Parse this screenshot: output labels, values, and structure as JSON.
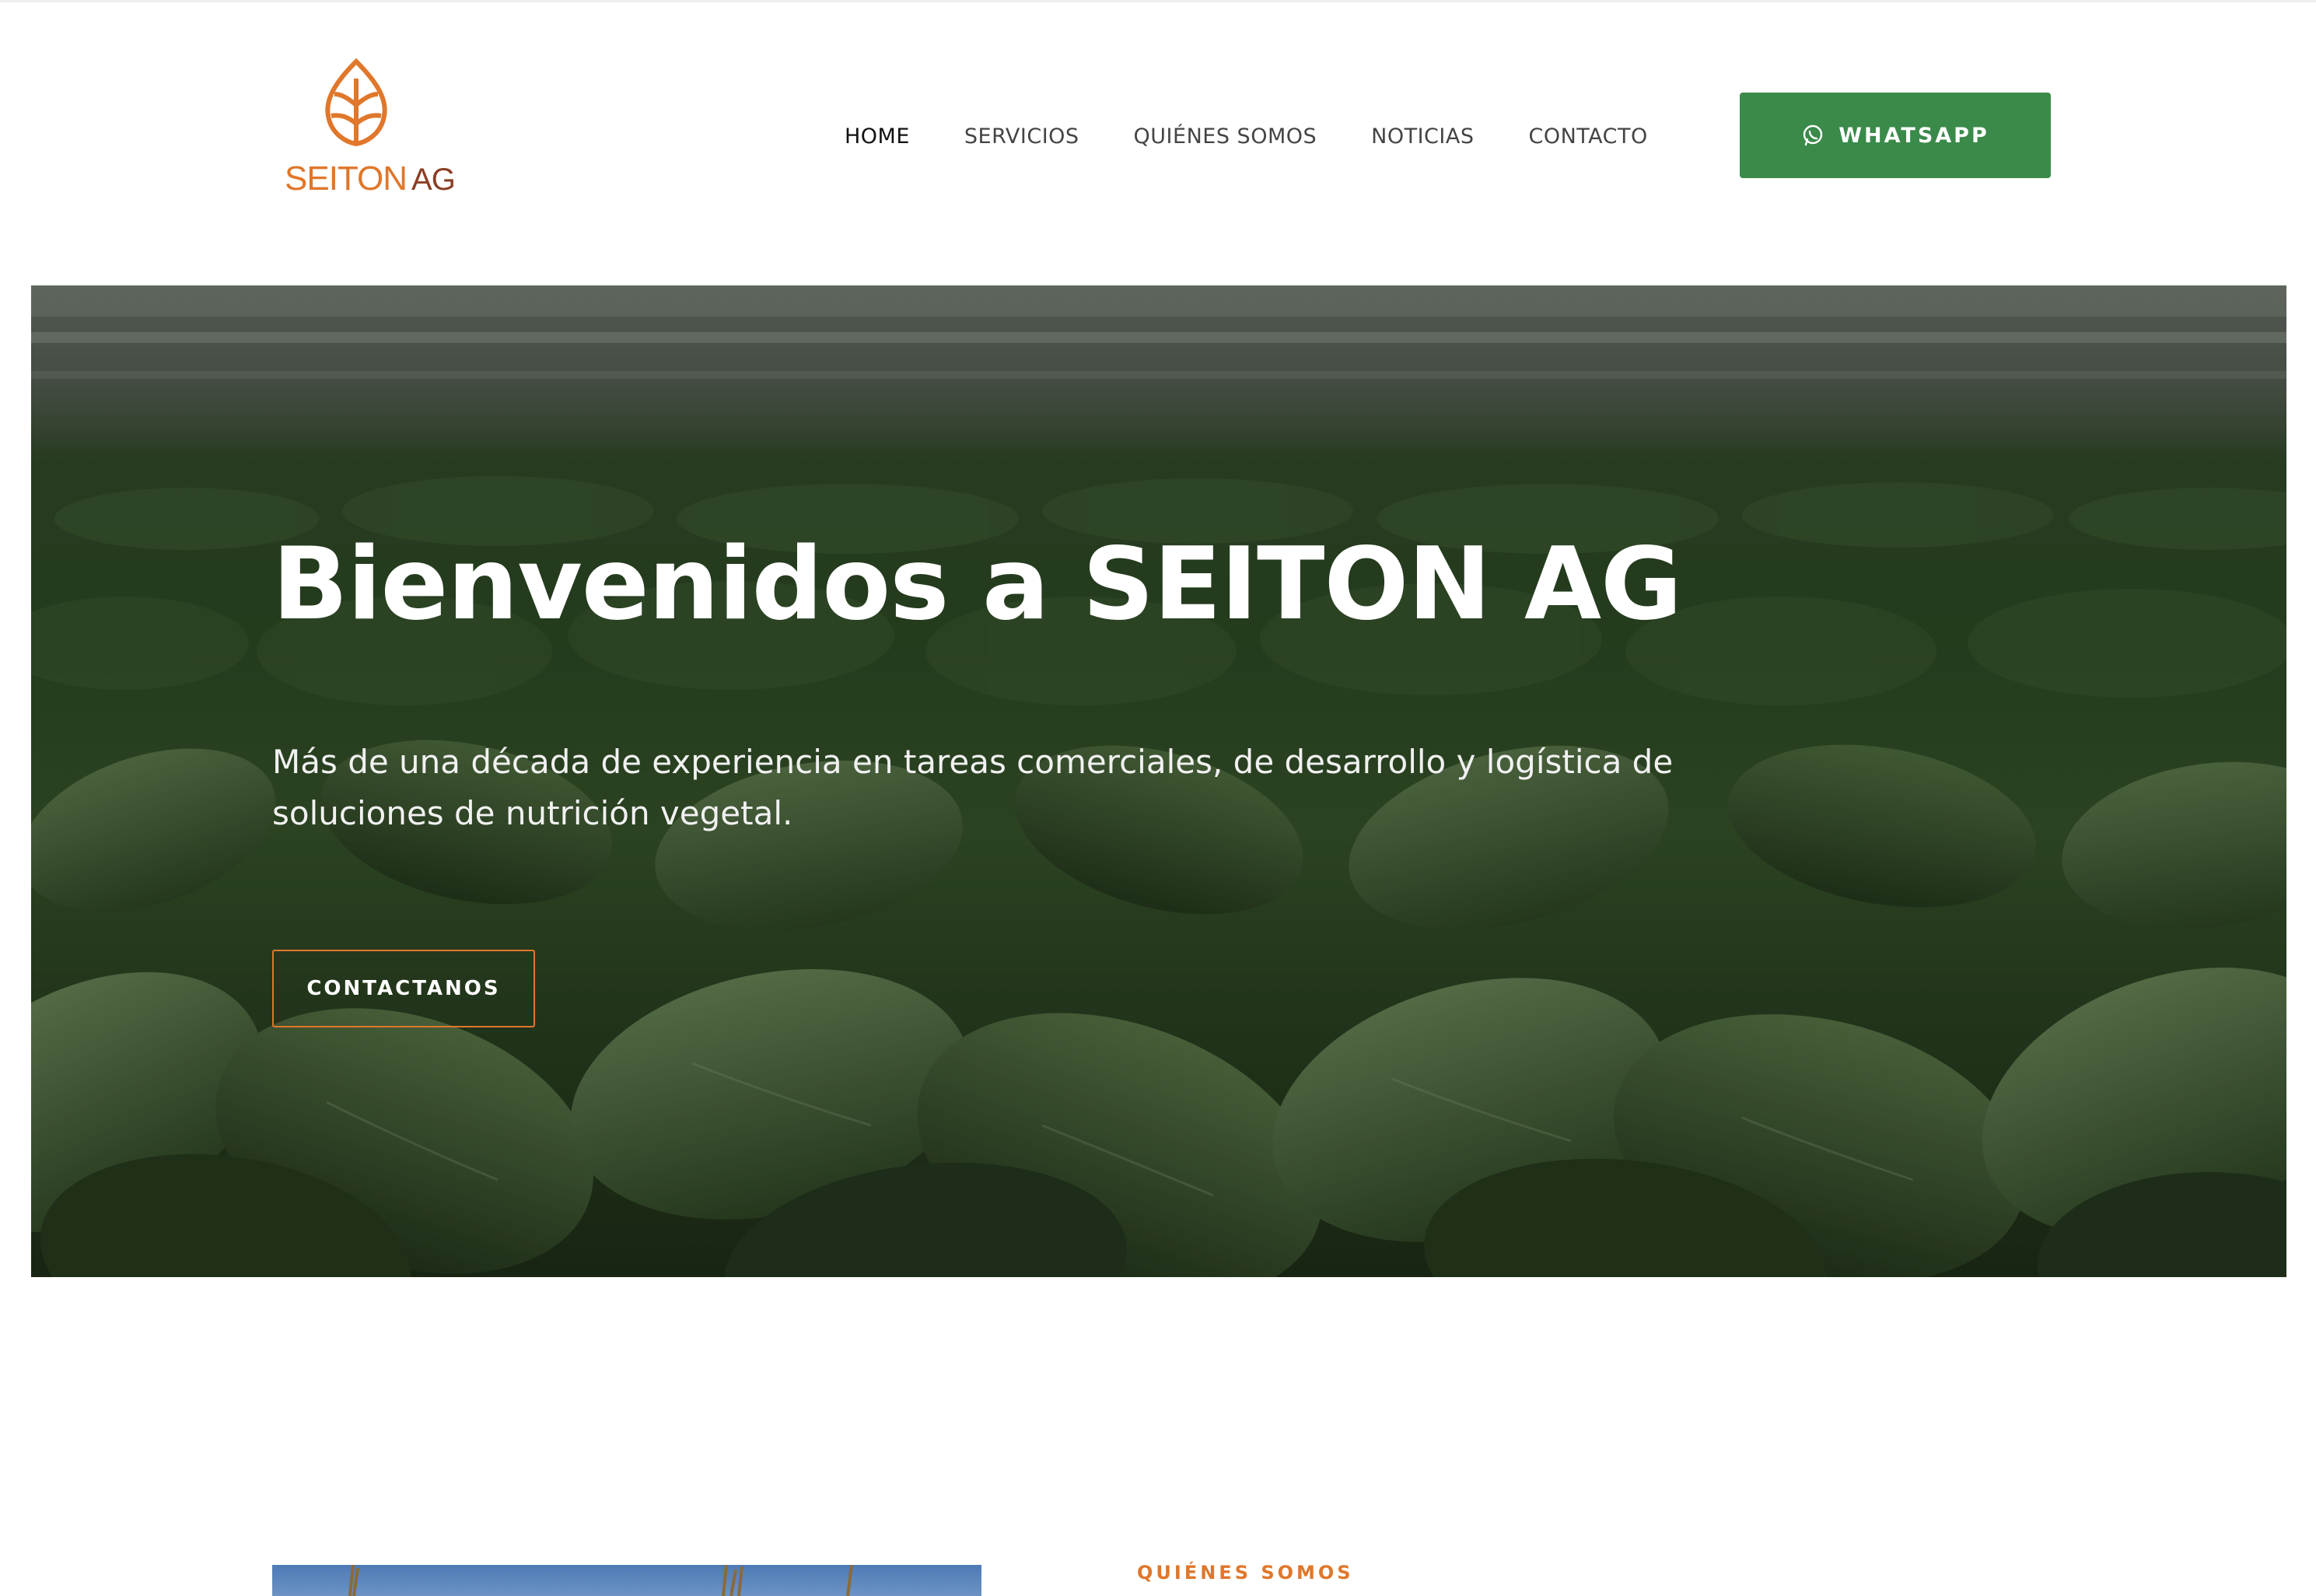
{
  "header": {
    "logo": {
      "text_main": "SEITON",
      "text_suffix": "AG",
      "colors": {
        "primary": "#e0772b",
        "secondary": "#8a3f24"
      }
    },
    "nav": [
      {
        "label": "HOME",
        "active": true
      },
      {
        "label": "SERVICIOS",
        "active": false
      },
      {
        "label": "QUIÉNES SOMOS",
        "active": false
      },
      {
        "label": "NOTICIAS",
        "active": false
      },
      {
        "label": "CONTACTO",
        "active": false
      }
    ],
    "whatsapp_button": {
      "label": "WHATSAPP",
      "icon": "whatsapp-icon",
      "color": "#3a8a4a"
    }
  },
  "hero": {
    "title": "Bienvenidos a SEITON AG",
    "subtitle": "Más de una década de experiencia en tareas comerciales, de desarrollo y logística de soluciones de nutrición vegetal.",
    "cta_label": "CONTACTANOS",
    "cta_border_color": "#e0772b"
  },
  "about": {
    "eyebrow": "QUIÉNES SOMOS"
  }
}
